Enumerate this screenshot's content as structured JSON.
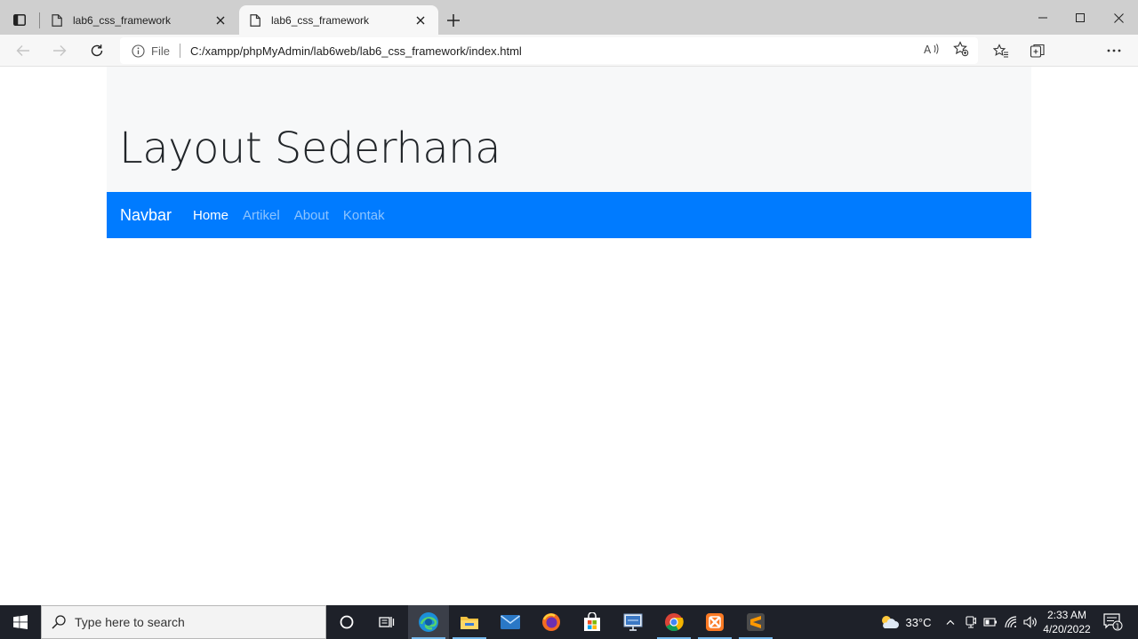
{
  "browser": {
    "tabs": [
      {
        "title": "lab6_css_framework",
        "active": false
      },
      {
        "title": "lab6_css_framework",
        "active": true
      }
    ],
    "address": {
      "scheme_label": "File",
      "url": "C:/xampp/phpMyAdmin/lab6web/lab6_css_framework/index.html"
    }
  },
  "page": {
    "heading": "Layout Sederhana",
    "navbar": {
      "brand": "Navbar",
      "links": [
        "Home",
        "Artikel",
        "About",
        "Kontak"
      ],
      "active": "Home"
    },
    "colors": {
      "navbar_bg": "#007bff",
      "jumbotron_bg": "#f7f8f9"
    }
  },
  "taskbar": {
    "search_placeholder": "Type here to search",
    "apps": [
      "cortana-icon",
      "task-view-icon",
      "edge-icon",
      "file-explorer-icon",
      "mail-icon",
      "firefox-icon",
      "store-icon",
      "remote-desktop-icon",
      "chrome-icon",
      "xampp-icon",
      "sublime-text-icon"
    ],
    "weather": "33°C",
    "time": "2:33 AM",
    "date": "4/20/2022",
    "notification_count": "1"
  }
}
